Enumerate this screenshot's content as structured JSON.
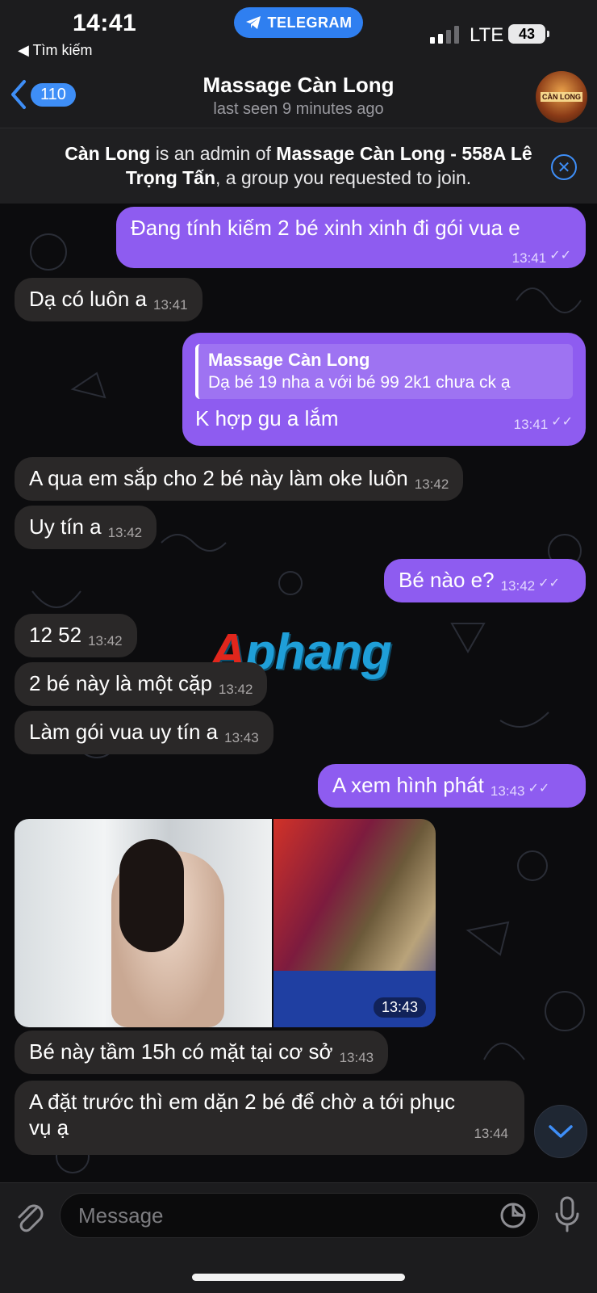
{
  "status_bar": {
    "time": "14:41",
    "back_label": "◀ Tìm kiếm",
    "app_pill": "TELEGRAM",
    "network": "LTE",
    "battery": "43"
  },
  "header": {
    "back_count": "110",
    "title": "Massage Càn Long",
    "subtitle": "last seen 9 minutes ago",
    "avatar_text": "CÀN LONG"
  },
  "banner": {
    "admin_name": "Càn Long",
    "text_mid": " is an admin of ",
    "group_name": "Massage Càn Long - 558A Lê Trọng Tấn",
    "text_end": ", a group you requested to join."
  },
  "watermark": {
    "first": "A",
    "rest": "phang"
  },
  "messages": [
    {
      "dir": "out",
      "text": "Đang tính kiếm 2 bé xinh xinh đi gói vua e",
      "time": "13:41"
    },
    {
      "dir": "in",
      "text": "Dạ có luôn a",
      "time": "13:41"
    },
    {
      "dir": "out",
      "reply_name": "Massage Càn Long",
      "reply_text": "Dạ bé 19 nha a với bé 99 2k1 chưa ck ạ",
      "text": "K hợp gu a lắm",
      "time": "13:41"
    },
    {
      "dir": "in",
      "text": "A qua em sắp cho 2 bé này làm oke luôn",
      "time": "13:42"
    },
    {
      "dir": "in",
      "text": "Uy tín a",
      "time": "13:42"
    },
    {
      "dir": "out",
      "text": "Bé nào e?",
      "time": "13:42"
    },
    {
      "dir": "in",
      "text": "12 52",
      "time": "13:42"
    },
    {
      "dir": "in",
      "text": "2 bé này là một cặp",
      "time": "13:42"
    },
    {
      "dir": "in",
      "text": "Làm gói vua uy tín a",
      "time": "13:43"
    },
    {
      "dir": "out",
      "text": "A xem hình phát",
      "time": "13:43"
    },
    {
      "dir": "in",
      "type": "album",
      "time": "13:43"
    },
    {
      "dir": "in",
      "text": "Bé này tầm 15h có mặt tại cơ sở",
      "time": "13:43"
    },
    {
      "dir": "in",
      "text_line1": "A đặt trước thì em dặn 2 bé để chờ a tới phục",
      "text_line2": "vụ ạ",
      "time": "13:44"
    }
  ],
  "input": {
    "placeholder": "Message"
  },
  "colors": {
    "outgoing": "#8e5cf0",
    "incoming": "#2a2828",
    "accent": "#3e8ef7"
  },
  "icons": [
    "attach-icon",
    "sticker-icon",
    "mic-icon",
    "chevron-down-icon",
    "telegram-icon",
    "close-icon"
  ]
}
